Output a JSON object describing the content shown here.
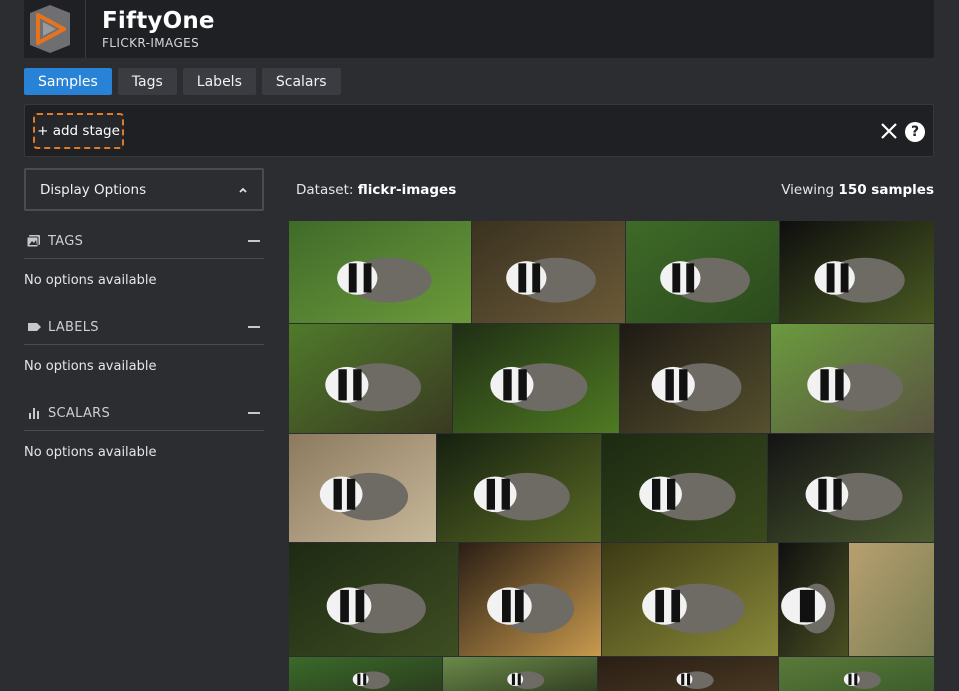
{
  "app": {
    "title": "FiftyOne",
    "subtitle": "FLICKR-IMAGES"
  },
  "tabs": [
    {
      "label": "Samples",
      "active": true
    },
    {
      "label": "Tags",
      "active": false
    },
    {
      "label": "Labels",
      "active": false
    },
    {
      "label": "Scalars",
      "active": false
    }
  ],
  "stage_bar": {
    "add_stage_label": "+ add stage",
    "help_glyph": "?"
  },
  "sidebar": {
    "display_options_label": "Display Options",
    "sections": [
      {
        "title": "TAGS",
        "icon": "image-tag-icon",
        "empty_text": "No options available"
      },
      {
        "title": "LABELS",
        "icon": "label-icon",
        "empty_text": "No options available"
      },
      {
        "title": "SCALARS",
        "icon": "bar-chart-icon",
        "empty_text": "No options available"
      }
    ]
  },
  "dataset": {
    "prefix": "Dataset:",
    "name": "flickr-images",
    "viewing_prefix": "Viewing",
    "viewing_count": "150 samples"
  },
  "colors": {
    "accent": "#2883d6",
    "add_stage_border": "#e07a25",
    "logo_orange": "#e8731e"
  }
}
